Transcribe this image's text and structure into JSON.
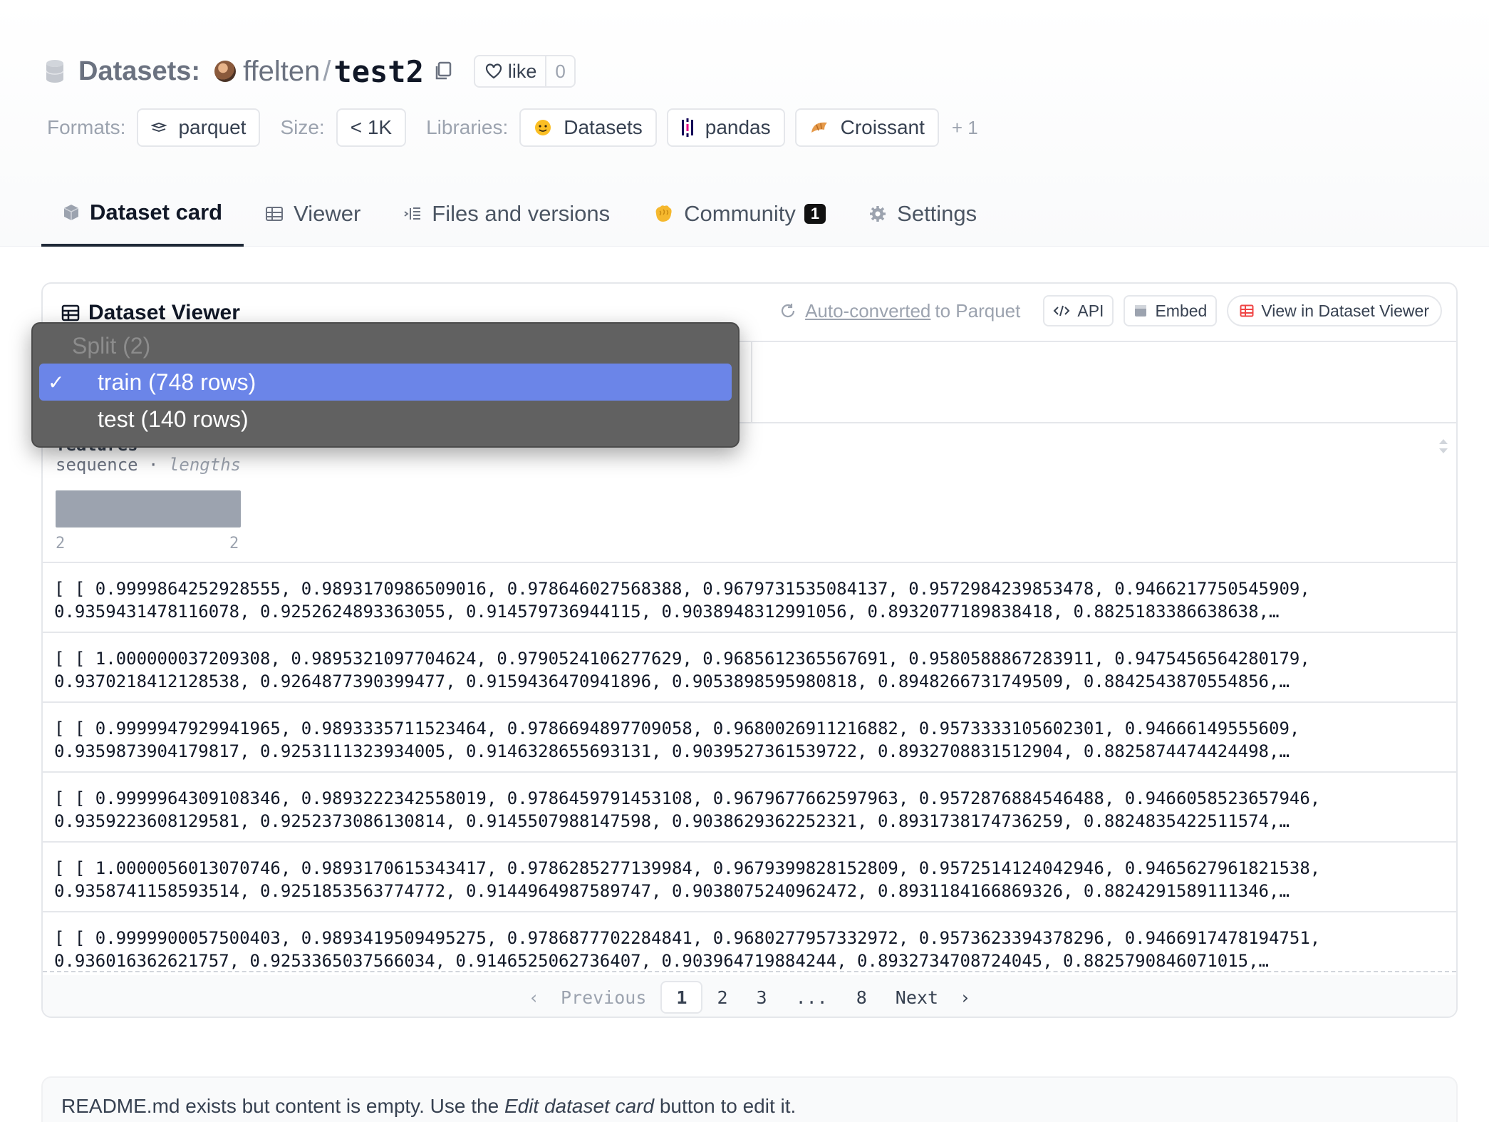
{
  "header": {
    "prefix": "Datasets:",
    "owner": "ffelten",
    "repo": "test2",
    "like_label": "like",
    "like_count": "0"
  },
  "meta": {
    "formats_label": "Formats:",
    "format": "parquet",
    "size_label": "Size:",
    "size": "< 1K",
    "libraries_label": "Libraries:",
    "libraries": [
      "Datasets",
      "pandas",
      "Croissant"
    ],
    "more": "+ 1"
  },
  "tabs": [
    {
      "label": "Dataset card",
      "icon": "cube-icon"
    },
    {
      "label": "Viewer",
      "icon": "table-icon"
    },
    {
      "label": "Files and versions",
      "icon": "files-icon"
    },
    {
      "label": "Community",
      "icon": "community-icon",
      "badge": "1"
    },
    {
      "label": "Settings",
      "icon": "gear-icon"
    }
  ],
  "viewer": {
    "title": "Dataset Viewer",
    "autoconv_link": "Auto-converted",
    "autoconv_rest": "to Parquet",
    "api_label": "API",
    "embed_label": "Embed",
    "view_label": "View in Dataset Viewer",
    "column": {
      "name": "features",
      "type": "sequence",
      "type_note": "lengths",
      "hist_min": "2",
      "hist_max": "2"
    },
    "rows": [
      "[ [ 0.9999864252928555, 0.9893170986509016, 0.978646027568388, 0.9679731535084137, 0.9572984239853478, 0.9466217750545909,\n0.9359431478116078, 0.9252624893363055, 0.914579736944115, 0.9038948312991056, 0.8932077189838418, 0.8825183386638638,…",
      "[ [ 1.000000037209308, 0.9895321097704624, 0.9790524106277629, 0.9685612365567691, 0.9580588867283911, 0.9475456564280179,\n0.9370218412128538, 0.9264877390399477, 0.9159436470941896, 0.9053898595980818, 0.8948266731749509, 0.8842543870554856,…",
      "[ [ 0.9999947929941965, 0.9893335711523464, 0.9786694897709058, 0.9680026911216882, 0.9573333105602301, 0.94666149555609,\n0.9359873904179817, 0.9253111323934005, 0.9146328655693131, 0.9039527361539722, 0.8932708831512904, 0.8825874474424498,…",
      "[ [ 0.9999964309108346, 0.9893222342558019, 0.9786459791453108, 0.9679677662597963, 0.9572876884546488, 0.9466058523657946,\n0.9359223608129581, 0.9252373086130814, 0.9145507988147598, 0.9038629362252321, 0.8931738174736259, 0.8824835422511574,…",
      "[ [ 1.0000056013070746, 0.9893170615343417, 0.9786285277139984, 0.9679399828152809, 0.9572514124042946, 0.9465627961821538,\n0.9358741158593514, 0.9251853563774772, 0.9144964987589747, 0.9038075240962472, 0.8931184166869326, 0.8824291589111346,…",
      "[ [ 0.9999900057500403, 0.9893419509495275, 0.9786877702284841, 0.9680277957332972, 0.9573623394378296, 0.9466917478194751,\n0.936016362621757, 0.9253365037566034, 0.9146525062736407, 0.903964719884244, 0.8932734708724045, 0.8825790846071015,…"
    ],
    "pager": {
      "previous": "Previous",
      "pages": [
        "1",
        "2",
        "3",
        "...",
        "8"
      ],
      "next": "Next"
    }
  },
  "dropdown": {
    "header": "Split (2)",
    "items": [
      {
        "label": "train (748 rows)",
        "selected": true
      },
      {
        "label": "test (140 rows)",
        "selected": false
      }
    ]
  },
  "readme": {
    "text_before": "README.md exists but content is empty. Use the ",
    "text_em": "Edit dataset card",
    "text_after": " button to edit it."
  }
}
